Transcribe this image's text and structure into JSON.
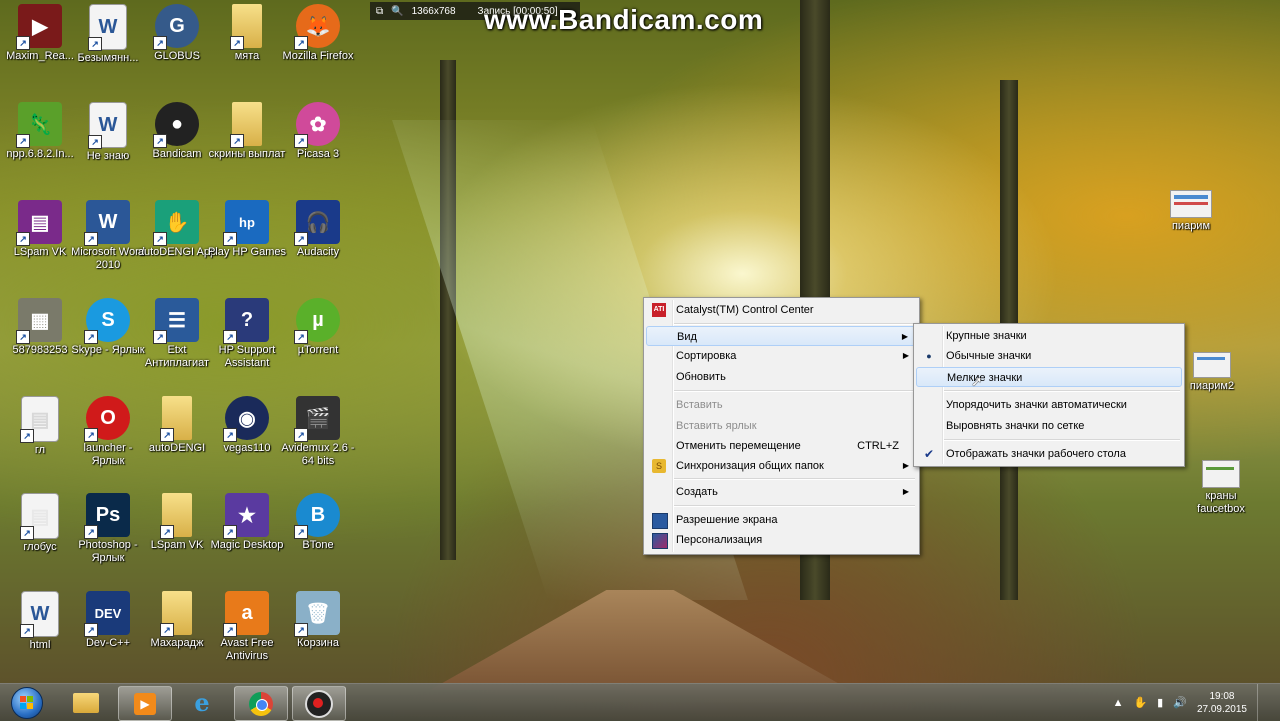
{
  "recorder": {
    "resolution": "1366x768",
    "status": "Запись [00:00:50]",
    "watermark": "www.Bandicam.com"
  },
  "desktop_icons": [
    {
      "label": "Maxim_Rea...",
      "icon": "video-thumbnail-icon",
      "color": "#7a1a1a"
    },
    {
      "label": "Безымянн...",
      "icon": "word-doc-icon",
      "color": "#2b5797"
    },
    {
      "label": "GLOBUS",
      "icon": "globus-app-icon",
      "color": "#355a8a"
    },
    {
      "label": "мята",
      "icon": "folder-icon",
      "color": "#e8c35a"
    },
    {
      "label": "Mozilla Firefox",
      "icon": "firefox-icon",
      "color": "#e66a1a"
    },
    {
      "label": "npp.6.8.2.In...",
      "icon": "notepad-plus-installer-icon",
      "color": "#5aa02a"
    },
    {
      "label": "Не знаю",
      "icon": "word-doc-icon",
      "color": "#2b5797"
    },
    {
      "label": "Bandicam",
      "icon": "bandicam-icon",
      "color": "#222222"
    },
    {
      "label": "скрины выплат",
      "icon": "folder-icon",
      "color": "#e8c35a"
    },
    {
      "label": "Picasa 3",
      "icon": "picasa-icon",
      "color": "#d04a9a"
    },
    {
      "label": "LSpam VK",
      "icon": "winrar-icon",
      "color": "#7a2a8a"
    },
    {
      "label": "Microsoft Word 2010",
      "icon": "word-app-icon",
      "color": "#2b5797"
    },
    {
      "label": "autoDENGI App",
      "icon": "autodengi-app-icon",
      "color": "#1aa07a"
    },
    {
      "label": "Play HP Games",
      "icon": "hp-games-icon",
      "color": "#1a6ac0"
    },
    {
      "label": "Audacity",
      "icon": "audacity-icon",
      "color": "#1a3a8a"
    },
    {
      "label": "587983253",
      "icon": "image-thumbnail-icon",
      "color": "#7a7a6a"
    },
    {
      "label": "Skype - Ярлык",
      "icon": "skype-icon",
      "color": "#1a9ae0"
    },
    {
      "label": "Etxt Антиплагиат",
      "icon": "etxt-icon",
      "color": "#2a5a9a"
    },
    {
      "label": "HP Support Assistant",
      "icon": "hp-support-icon",
      "color": "#2a3a7a"
    },
    {
      "label": "µTorrent",
      "icon": "utorrent-icon",
      "color": "#5ab02a"
    },
    {
      "label": "гл",
      "icon": "document-thumbnail-icon",
      "color": "#d8d8d8"
    },
    {
      "label": "launcher - Ярлык",
      "icon": "opera-icon",
      "color": "#d01a1a"
    },
    {
      "label": "autoDENGI",
      "icon": "folder-icon",
      "color": "#e8c35a"
    },
    {
      "label": "vegas110",
      "icon": "vegas-icon",
      "color": "#1a2a5a"
    },
    {
      "label": "Avidemux 2.6 - 64 bits",
      "icon": "avidemux-icon",
      "color": "#333333"
    },
    {
      "label": "глобус",
      "icon": "document-thumbnail-icon",
      "color": "#e8e8e8"
    },
    {
      "label": "Photoshop - Ярлык",
      "icon": "photoshop-icon",
      "color": "#0a2a4a"
    },
    {
      "label": "LSpam VK",
      "icon": "folder-icon",
      "color": "#e8c35a"
    },
    {
      "label": "Magic Desktop",
      "icon": "magic-desktop-icon",
      "color": "#5a3aa0"
    },
    {
      "label": "BTone",
      "icon": "btone-icon",
      "color": "#1a8ad0"
    },
    {
      "label": "html",
      "icon": "word-doc-icon",
      "color": "#2b5797"
    },
    {
      "label": "Dev-C++",
      "icon": "dev-cpp-icon",
      "color": "#1a3a7a"
    },
    {
      "label": "Махарадж",
      "icon": "folder-icon",
      "color": "#e8c35a"
    },
    {
      "label": "Avast Free Antivirus",
      "icon": "avast-icon",
      "color": "#e87a1a"
    },
    {
      "label": "Корзина",
      "icon": "recycle-bin-icon",
      "color": "#8ab0c8"
    }
  ],
  "right_icons": [
    {
      "label": "пиарим",
      "icon": "document-thumbnail-icon"
    },
    {
      "label": "пиарим2",
      "icon": "document-thumbnail-icon"
    },
    {
      "label": "краны faucetbox",
      "icon": "document-thumbnail-icon"
    }
  ],
  "context_menu": {
    "catalyst": "Catalyst(TM) Control Center",
    "view": "Вид",
    "sort": "Сортировка",
    "refresh": "Обновить",
    "paste": "Вставить",
    "paste_shortcut": "Вставить ярлык",
    "undo_move": "Отменить перемещение",
    "undo_shortcut": "CTRL+Z",
    "sync": "Синхронизация общих папок",
    "new": "Создать",
    "resolution": "Разрешение экрана",
    "personalize": "Персонализация"
  },
  "view_submenu": {
    "large": "Крупные значки",
    "medium": "Обычные значки",
    "small": "Мелкие значки",
    "auto_arrange": "Упорядочить значки автоматически",
    "align_grid": "Выровнять значки по сетке",
    "show_icons": "Отображать значки рабочего стола"
  },
  "taskbar": {
    "time": "19:08",
    "date": "27.09.2015",
    "apps": [
      "explorer",
      "media-player",
      "internet-explorer",
      "chrome",
      "bandicam"
    ]
  }
}
